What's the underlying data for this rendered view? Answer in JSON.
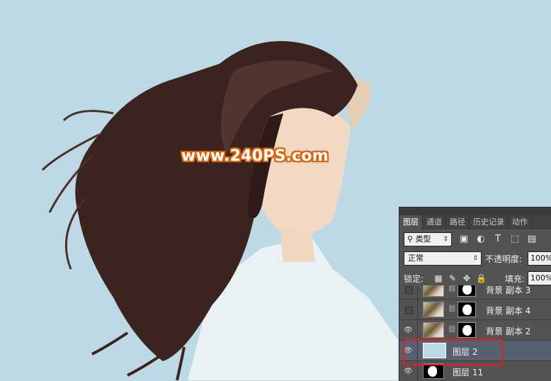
{
  "watermark": "www.240PS.com",
  "panel": {
    "tabs": [
      "图层",
      "通道",
      "路径",
      "历史记录",
      "动作"
    ],
    "filter": {
      "label": "类型",
      "icons": [
        "image-filter-icon",
        "adjustment-filter-icon",
        "type-filter-icon",
        "shape-filter-icon",
        "smart-object-filter-icon"
      ]
    },
    "blend_mode": "正常",
    "opacity_label": "不透明度:",
    "opacity_value": "100%",
    "lock_label": "锁定:",
    "lock_icons": [
      "lock-transparent-icon",
      "lock-brush-icon",
      "lock-move-icon",
      "lock-all-icon"
    ],
    "fill_label": "填充:",
    "fill_value": "100%",
    "layers": [
      {
        "name": "背景 副本 3",
        "visible": false,
        "has_mask": true
      },
      {
        "name": "背景 副本 4",
        "visible": false,
        "has_mask": true
      },
      {
        "name": "背景 副本 2",
        "visible": true,
        "has_mask": true
      },
      {
        "name": "图层 2",
        "visible": true,
        "selected": true,
        "fill_color": "#bcd9e5"
      },
      {
        "name": "图层 11",
        "visible": true
      }
    ]
  },
  "colors": {
    "canvas_bg": "#bcd9e5",
    "highlight": "#e11d1d",
    "panel_bg": "#535353"
  }
}
